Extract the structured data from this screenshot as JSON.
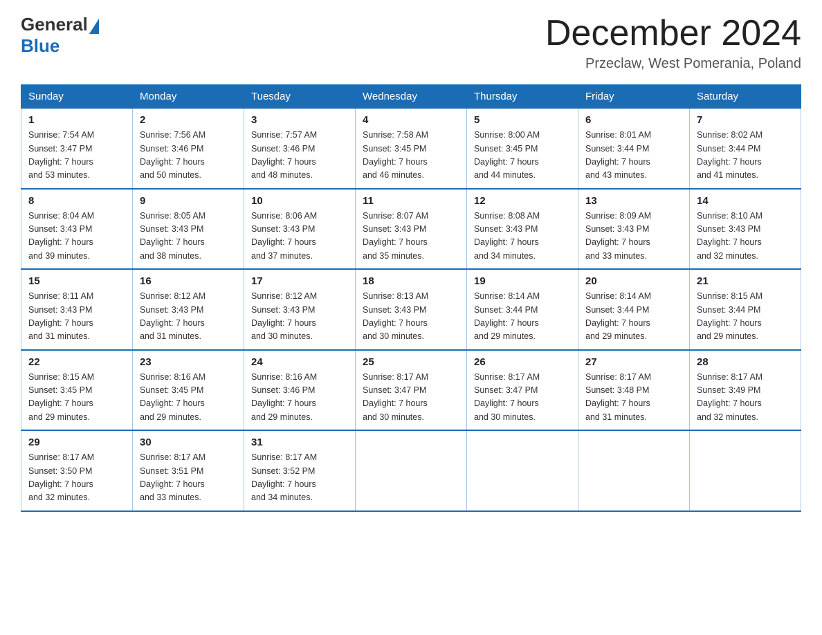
{
  "header": {
    "logo_general": "General",
    "logo_blue": "Blue",
    "month_title": "December 2024",
    "location": "Przeclaw, West Pomerania, Poland"
  },
  "weekdays": [
    "Sunday",
    "Monday",
    "Tuesday",
    "Wednesday",
    "Thursday",
    "Friday",
    "Saturday"
  ],
  "weeks": [
    [
      {
        "day": "1",
        "sunrise": "7:54 AM",
        "sunset": "3:47 PM",
        "daylight": "7 hours and 53 minutes."
      },
      {
        "day": "2",
        "sunrise": "7:56 AM",
        "sunset": "3:46 PM",
        "daylight": "7 hours and 50 minutes."
      },
      {
        "day": "3",
        "sunrise": "7:57 AM",
        "sunset": "3:46 PM",
        "daylight": "7 hours and 48 minutes."
      },
      {
        "day": "4",
        "sunrise": "7:58 AM",
        "sunset": "3:45 PM",
        "daylight": "7 hours and 46 minutes."
      },
      {
        "day": "5",
        "sunrise": "8:00 AM",
        "sunset": "3:45 PM",
        "daylight": "7 hours and 44 minutes."
      },
      {
        "day": "6",
        "sunrise": "8:01 AM",
        "sunset": "3:44 PM",
        "daylight": "7 hours and 43 minutes."
      },
      {
        "day": "7",
        "sunrise": "8:02 AM",
        "sunset": "3:44 PM",
        "daylight": "7 hours and 41 minutes."
      }
    ],
    [
      {
        "day": "8",
        "sunrise": "8:04 AM",
        "sunset": "3:43 PM",
        "daylight": "7 hours and 39 minutes."
      },
      {
        "day": "9",
        "sunrise": "8:05 AM",
        "sunset": "3:43 PM",
        "daylight": "7 hours and 38 minutes."
      },
      {
        "day": "10",
        "sunrise": "8:06 AM",
        "sunset": "3:43 PM",
        "daylight": "7 hours and 37 minutes."
      },
      {
        "day": "11",
        "sunrise": "8:07 AM",
        "sunset": "3:43 PM",
        "daylight": "7 hours and 35 minutes."
      },
      {
        "day": "12",
        "sunrise": "8:08 AM",
        "sunset": "3:43 PM",
        "daylight": "7 hours and 34 minutes."
      },
      {
        "day": "13",
        "sunrise": "8:09 AM",
        "sunset": "3:43 PM",
        "daylight": "7 hours and 33 minutes."
      },
      {
        "day": "14",
        "sunrise": "8:10 AM",
        "sunset": "3:43 PM",
        "daylight": "7 hours and 32 minutes."
      }
    ],
    [
      {
        "day": "15",
        "sunrise": "8:11 AM",
        "sunset": "3:43 PM",
        "daylight": "7 hours and 31 minutes."
      },
      {
        "day": "16",
        "sunrise": "8:12 AM",
        "sunset": "3:43 PM",
        "daylight": "7 hours and 31 minutes."
      },
      {
        "day": "17",
        "sunrise": "8:12 AM",
        "sunset": "3:43 PM",
        "daylight": "7 hours and 30 minutes."
      },
      {
        "day": "18",
        "sunrise": "8:13 AM",
        "sunset": "3:43 PM",
        "daylight": "7 hours and 30 minutes."
      },
      {
        "day": "19",
        "sunrise": "8:14 AM",
        "sunset": "3:44 PM",
        "daylight": "7 hours and 29 minutes."
      },
      {
        "day": "20",
        "sunrise": "8:14 AM",
        "sunset": "3:44 PM",
        "daylight": "7 hours and 29 minutes."
      },
      {
        "day": "21",
        "sunrise": "8:15 AM",
        "sunset": "3:44 PM",
        "daylight": "7 hours and 29 minutes."
      }
    ],
    [
      {
        "day": "22",
        "sunrise": "8:15 AM",
        "sunset": "3:45 PM",
        "daylight": "7 hours and 29 minutes."
      },
      {
        "day": "23",
        "sunrise": "8:16 AM",
        "sunset": "3:45 PM",
        "daylight": "7 hours and 29 minutes."
      },
      {
        "day": "24",
        "sunrise": "8:16 AM",
        "sunset": "3:46 PM",
        "daylight": "7 hours and 29 minutes."
      },
      {
        "day": "25",
        "sunrise": "8:17 AM",
        "sunset": "3:47 PM",
        "daylight": "7 hours and 30 minutes."
      },
      {
        "day": "26",
        "sunrise": "8:17 AM",
        "sunset": "3:47 PM",
        "daylight": "7 hours and 30 minutes."
      },
      {
        "day": "27",
        "sunrise": "8:17 AM",
        "sunset": "3:48 PM",
        "daylight": "7 hours and 31 minutes."
      },
      {
        "day": "28",
        "sunrise": "8:17 AM",
        "sunset": "3:49 PM",
        "daylight": "7 hours and 32 minutes."
      }
    ],
    [
      {
        "day": "29",
        "sunrise": "8:17 AM",
        "sunset": "3:50 PM",
        "daylight": "7 hours and 32 minutes."
      },
      {
        "day": "30",
        "sunrise": "8:17 AM",
        "sunset": "3:51 PM",
        "daylight": "7 hours and 33 minutes."
      },
      {
        "day": "31",
        "sunrise": "8:17 AM",
        "sunset": "3:52 PM",
        "daylight": "7 hours and 34 minutes."
      },
      null,
      null,
      null,
      null
    ]
  ],
  "labels": {
    "sunrise": "Sunrise:",
    "sunset": "Sunset:",
    "daylight": "Daylight:"
  }
}
